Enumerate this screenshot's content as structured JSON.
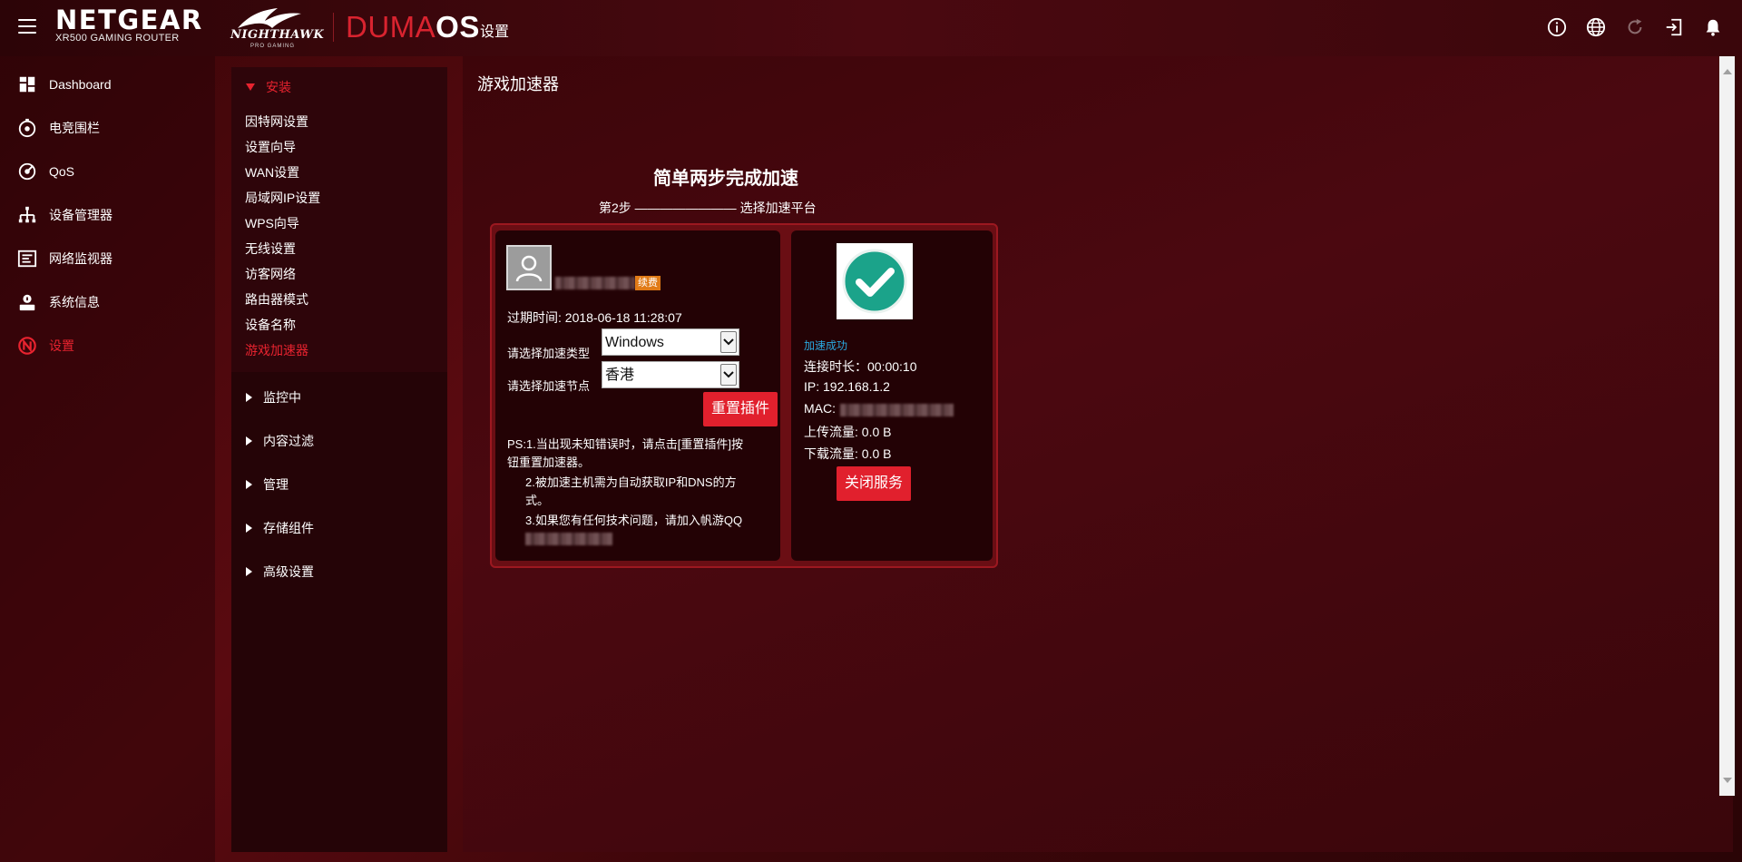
{
  "header": {
    "brand": "NETGEAR",
    "model": "XR500 GAMING ROUTER",
    "sub_brand": "NIGHTHAWK",
    "sub_brand_tag": "PRO GAMING",
    "os_name_part1": "DUMA",
    "os_name_part2": "OS",
    "page_title": "设置",
    "icons": [
      "info-icon",
      "globe-icon",
      "refresh-icon",
      "logout-icon",
      "bell-icon"
    ]
  },
  "sidebar": {
    "items": [
      {
        "label": "Dashboard",
        "icon": "dashboard-icon"
      },
      {
        "label": "电竞围栏",
        "icon": "geofence-icon"
      },
      {
        "label": "QoS",
        "icon": "qos-icon"
      },
      {
        "label": "设备管理器",
        "icon": "device-manager-icon"
      },
      {
        "label": "网络监视器",
        "icon": "network-monitor-icon"
      },
      {
        "label": "系统信息",
        "icon": "system-info-icon"
      },
      {
        "label": "设置",
        "icon": "settings-icon",
        "active": true
      }
    ]
  },
  "subnav": {
    "open_section": "安装",
    "links": [
      "因特网设置",
      "设置向导",
      "WAN设置",
      "局域网IP设置",
      "WPS向导",
      "无线设置",
      "访客网络",
      "路由器模式",
      "设备名称",
      "游戏加速器"
    ],
    "active_link": "游戏加速器",
    "sections": [
      "监控中",
      "内容过滤",
      "管理",
      "存储组件",
      "高级设置"
    ]
  },
  "main": {
    "title": "游戏加速器",
    "plugin": {
      "heading": "简单两步完成加速",
      "step": "第2步 ———————— 选择加速平台",
      "account_badge": "续费",
      "expire_text": "过期时间: 2018-06-18 11:28:07",
      "type_label": "请选择加速类型",
      "type_value": "Windows",
      "node_label": "请选择加速节点",
      "node_value": "香港",
      "reset_button": "重置插件",
      "notes": {
        "line1": "PS:1.当出现未知错误时，请点击[重置插件]按",
        "line1b": "钮重置加速器。",
        "line2": "2.被加速主机需为自动获取IP和DNS的方",
        "line2b": "式。",
        "line3": "3.如果您有任何技术问题，请加入帆游QQ"
      },
      "status": "加速成功",
      "connect_time": "连接时长：00:00:10",
      "ip": "IP: 192.168.1.2",
      "mac_label": "MAC:",
      "upload": "上传流量: 0.0 B",
      "download": "下载流量: 0.0 B",
      "stop_button": "关闭服务",
      "colors": {
        "accent": "#e1202d",
        "success": "#2aa9e0",
        "check_circle": "#1ba38a",
        "badge": "#e07a16"
      }
    }
  }
}
